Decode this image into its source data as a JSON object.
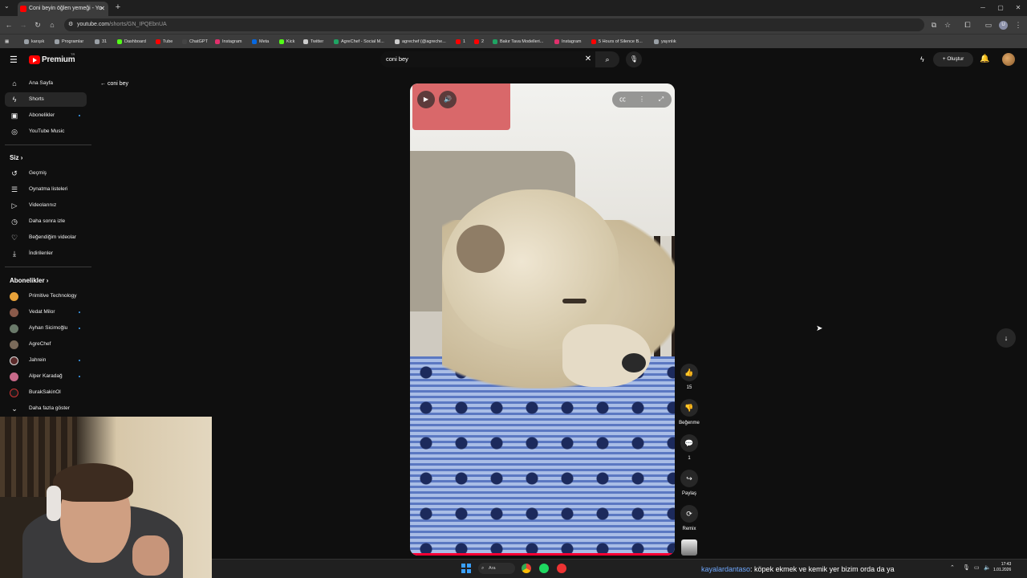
{
  "browser": {
    "tab_title": "Coni beyin öğlen yemeği - Yo",
    "url_host": "youtube.com",
    "url_path": "/shorts/GN_IPQEbnUA",
    "bookmarks": [
      {
        "label": "karışık",
        "color": "#9aa0a6"
      },
      {
        "label": "Programlar",
        "color": "#9aa0a6"
      },
      {
        "label": "31",
        "color": "#9aa0a6"
      },
      {
        "label": "Dashboard",
        "color": "#53fc18"
      },
      {
        "label": "Tube",
        "color": "#ff0000"
      },
      {
        "label": "ChatGPT",
        "color": "#444444"
      },
      {
        "label": "Instagram",
        "color": "#e1306c"
      },
      {
        "label": "Meta",
        "color": "#0668e1"
      },
      {
        "label": "Kick",
        "color": "#53fc18"
      },
      {
        "label": "Twitter",
        "color": "#cccccc"
      },
      {
        "label": "AgreChef - Social M...",
        "color": "#1fa463"
      },
      {
        "label": "agrechef (@agreche...",
        "color": "#cccccc"
      },
      {
        "label": "1",
        "color": "#ff0000"
      },
      {
        "label": "2",
        "color": "#ff0000"
      },
      {
        "label": "Bakır Tava Modelleri...",
        "color": "#1fa463"
      },
      {
        "label": "Instagram",
        "color": "#e1306c"
      },
      {
        "label": "5 Hours of Silence B...",
        "color": "#ff0000"
      },
      {
        "label": "yayınlık",
        "color": "#9aa0a6"
      }
    ]
  },
  "youtube": {
    "logo_text": "Premium",
    "logo_region": "TR",
    "search_value": "coni bey",
    "create_label": "Oluştur",
    "back_label": "coni bey",
    "sidebar_main": [
      {
        "label": "Ana Sayfa",
        "icon": "home-icon",
        "glyph": "⌂"
      },
      {
        "label": "Shorts",
        "icon": "shorts-icon",
        "glyph": "ϟ",
        "active": true
      },
      {
        "label": "Abonelikler",
        "icon": "subscriptions-icon",
        "glyph": "▣",
        "dot": true
      },
      {
        "label": "YouTube Music",
        "icon": "music-icon",
        "glyph": "◎"
      }
    ],
    "siz_header": "Siz",
    "sidebar_you": [
      {
        "label": "Geçmiş",
        "icon": "history-icon",
        "glyph": "↺"
      },
      {
        "label": "Oynatma listeleri",
        "icon": "playlists-icon",
        "glyph": "☰"
      },
      {
        "label": "Videolarınız",
        "icon": "your-videos-icon",
        "glyph": "▷"
      },
      {
        "label": "Daha sonra izle",
        "icon": "watch-later-icon",
        "glyph": "◷"
      },
      {
        "label": "Beğendiğim videolar",
        "icon": "liked-videos-icon",
        "glyph": "👍"
      },
      {
        "label": "İndirilenler",
        "icon": "downloads-icon",
        "glyph": "⤓"
      }
    ],
    "subs_header": "Abonelikler",
    "subscriptions": [
      {
        "label": "Primitive Technology",
        "color": "#e8a23a",
        "dot": false
      },
      {
        "label": "Vedat Milor",
        "color": "#8a5a4a",
        "dot": true
      },
      {
        "label": "Ayhan Sicimoğlu",
        "color": "#6a7a6a",
        "dot": true
      },
      {
        "label": "AgreChef",
        "color": "#7a6a5a",
        "dot": false
      },
      {
        "label": "Jahrein",
        "color": "#5a2a2a",
        "dot": true
      },
      {
        "label": "Alper Karadağ",
        "color": "#c86a8a",
        "dot": true
      },
      {
        "label": "BurakSakinOl",
        "color": "#1a1a1a",
        "dot": false
      }
    ],
    "show_more": "Daha fazla göster",
    "actions": {
      "like_count": "15",
      "dislike_label": "Beğenme",
      "comments_count": "1",
      "share_label": "Paylaş",
      "remix_label": "Remix"
    }
  },
  "taskbar": {
    "search_label": "Ara",
    "ticker_user": "kayalardantaso",
    "ticker_text": ": köpek ekmek ve kemik yer bizim orda da ya",
    "time": "17:43",
    "date": "1.01.2026"
  }
}
